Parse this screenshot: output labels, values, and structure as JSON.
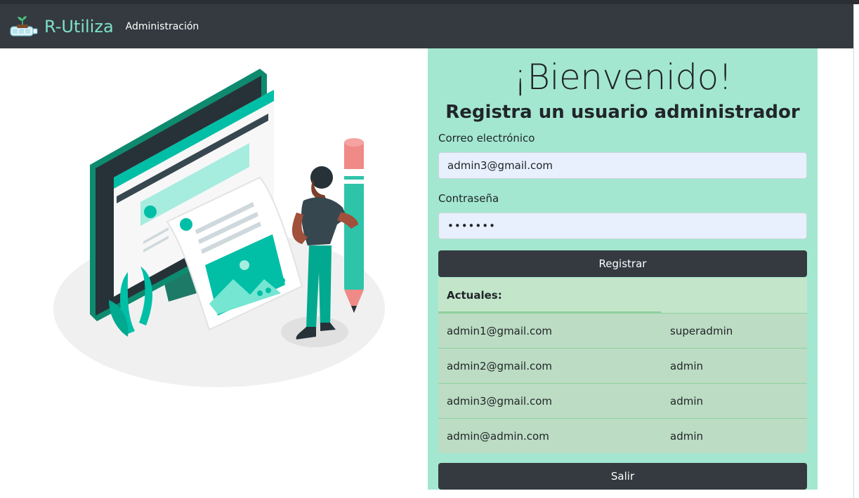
{
  "navbar": {
    "brand": "R-Utiliza",
    "link": "Administración",
    "logo_icon": "bottle-plant-icon"
  },
  "panel": {
    "title": "¡Bienvenido!",
    "subtitle": "Registra un usuario administrador",
    "email_label": "Correo electrónico",
    "email_value": "admin3@gmail.com",
    "password_label": "Contraseña",
    "password_value": "•••••••",
    "register_button": "Registrar",
    "table_header": "Actuales:",
    "users": [
      {
        "email": "admin1@gmail.com",
        "role": "superadmin"
      },
      {
        "email": "admin2@gmail.com",
        "role": "admin"
      },
      {
        "email": "admin3@gmail.com",
        "role": "admin"
      },
      {
        "email": "admin@admin.com",
        "role": "admin"
      }
    ],
    "exit_button": "Salir"
  },
  "colors": {
    "navbar": "#343a40",
    "brand": "#7ee0c8",
    "panel": "#a3e7d0",
    "table_header": "#c3e6cb",
    "table_row": "#bcdcc4",
    "accent": "#00bfa6"
  }
}
